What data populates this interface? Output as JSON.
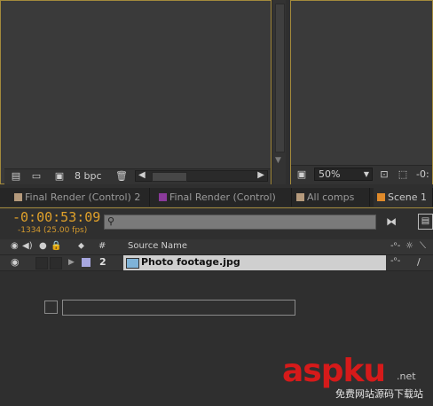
{
  "project_panel": {
    "bpc_label": "8 bpc"
  },
  "comp_panel": {
    "zoom_value": "50%",
    "zoom_arrow": "▼",
    "suffix": "-0:"
  },
  "tabs": [
    {
      "label": "Final Render (Control) 2",
      "color": "#b59a7c"
    },
    {
      "label": "Final Render (Control)",
      "color": "#8a3a9a"
    },
    {
      "label": "All comps",
      "color": "#b59a7c"
    },
    {
      "label": "Scene 1",
      "color": "#e08a2a"
    }
  ],
  "timeline": {
    "timecode": "-0:00:53:09",
    "frames": "-1334 (25.00 fps)",
    "search_placeholder": "",
    "search_icon": "⚲",
    "columns": {
      "number": "#",
      "source_name": "Source Name"
    }
  },
  "layer": {
    "number": "2",
    "name": "Photo footage.jpg",
    "label_color": "#a7a7e0"
  },
  "watermark": {
    "main": "aspku",
    "suffix": ".net",
    "sub": "免费网站源码下载站"
  }
}
